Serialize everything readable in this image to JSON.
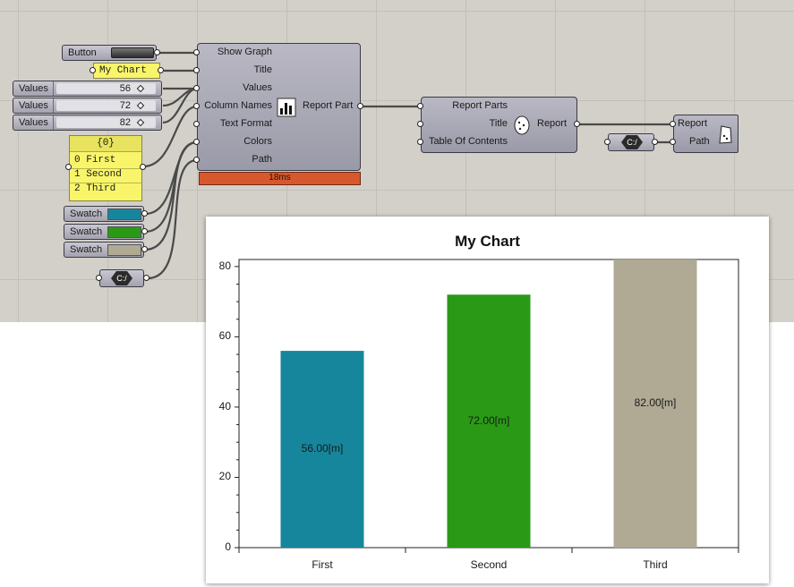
{
  "nodes": {
    "button": {
      "label": "Button"
    },
    "title_panel": {
      "text": "My Chart"
    },
    "sliders": [
      {
        "name": "Values",
        "value": "56"
      },
      {
        "name": "Values",
        "value": "72"
      },
      {
        "name": "Values",
        "value": "82"
      }
    ],
    "column_panel": {
      "header": "{0}",
      "rows": [
        {
          "index": "0",
          "text": "First"
        },
        {
          "index": "1",
          "text": "Second"
        },
        {
          "index": "2",
          "text": "Third"
        }
      ]
    },
    "swatches": [
      {
        "label": "Swatch",
        "color": "#16869c"
      },
      {
        "label": "Swatch",
        "color": "#2a9a16"
      },
      {
        "label": "Swatch",
        "color": "#b0a994"
      }
    ],
    "path_component": {
      "icon": "C:/"
    },
    "report_part": {
      "inputs": [
        "Show Graph",
        "Title",
        "Values",
        "Column Names",
        "Text Format",
        "Colors",
        "Path"
      ],
      "output": "Report Part",
      "timer": "18ms",
      "icon": "bar-chart-icon"
    },
    "report": {
      "inputs": [
        "Report Parts",
        "Title",
        "Table Of Contents"
      ],
      "output": "Report",
      "icon": "egg-icon"
    },
    "path_component_2": {
      "icon": "C:/"
    },
    "report_output": {
      "inputs": [
        "Report",
        "Path"
      ],
      "icon": "document-icon"
    }
  },
  "chart_data": {
    "type": "bar",
    "title": "My Chart",
    "categories": [
      "First",
      "Second",
      "Third"
    ],
    "values": [
      56,
      72,
      82
    ],
    "value_labels": [
      "56.00[m]",
      "72.00[m]",
      "82.00[m]"
    ],
    "colors": [
      "#16869c",
      "#2a9a16",
      "#b0a994"
    ],
    "ylim": [
      0,
      82
    ],
    "yticks": [
      0,
      20,
      40,
      60,
      80
    ],
    "ytick_labels": [
      "0",
      "20",
      "40",
      "60",
      "80"
    ],
    "xlabel": "",
    "ylabel": "",
    "grid": false
  }
}
